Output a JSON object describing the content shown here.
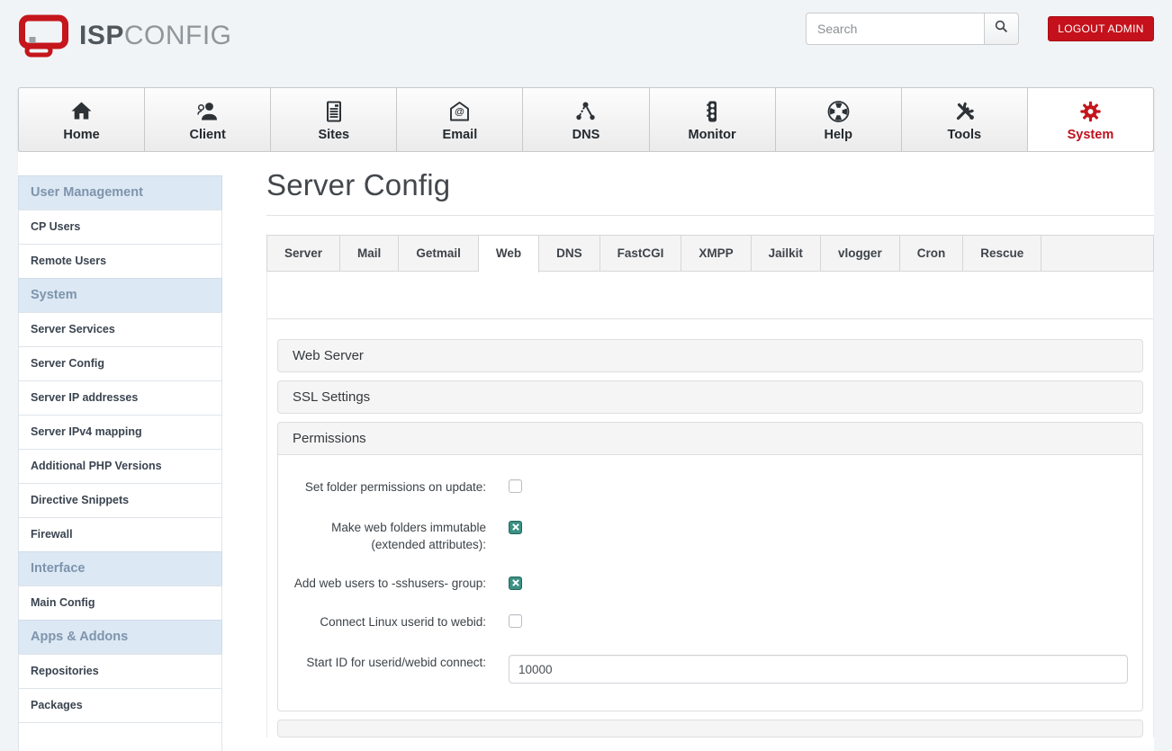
{
  "header": {
    "logo": {
      "text_bold": "ISP",
      "text_light": "CONFIG",
      "icon": "ispconfig-monitor-logo"
    },
    "search": {
      "placeholder": "Search",
      "icon": "search-icon"
    },
    "logout_label": "LOGOUT ADMIN"
  },
  "nav": {
    "items": [
      {
        "label": "Home",
        "icon": "home-icon",
        "active": false
      },
      {
        "label": "Client",
        "icon": "client-icon",
        "active": false
      },
      {
        "label": "Sites",
        "icon": "sites-icon",
        "active": false
      },
      {
        "label": "Email",
        "icon": "email-icon",
        "active": false
      },
      {
        "label": "DNS",
        "icon": "dns-icon",
        "active": false
      },
      {
        "label": "Monitor",
        "icon": "traffic-light-icon",
        "active": false
      },
      {
        "label": "Help",
        "icon": "life-ring-icon",
        "active": false
      },
      {
        "label": "Tools",
        "icon": "tools-icon",
        "active": false
      },
      {
        "label": "System",
        "icon": "gear-icon",
        "active": true
      }
    ]
  },
  "sidebar": {
    "rows": [
      {
        "type": "header",
        "label": "User Management"
      },
      {
        "type": "item",
        "label": "CP Users"
      },
      {
        "type": "item",
        "label": "Remote Users"
      },
      {
        "type": "header",
        "label": "System"
      },
      {
        "type": "item",
        "label": "Server Services"
      },
      {
        "type": "item",
        "label": "Server Config"
      },
      {
        "type": "item",
        "label": "Server IP addresses"
      },
      {
        "type": "item",
        "label": "Server IPv4 mapping"
      },
      {
        "type": "item",
        "label": "Additional PHP Versions"
      },
      {
        "type": "item",
        "label": "Directive Snippets"
      },
      {
        "type": "item",
        "label": "Firewall"
      },
      {
        "type": "header",
        "label": "Interface"
      },
      {
        "type": "item",
        "label": "Main Config"
      },
      {
        "type": "header",
        "label": "Apps & Addons"
      },
      {
        "type": "item",
        "label": "Repositories"
      },
      {
        "type": "item",
        "label": "Packages"
      }
    ]
  },
  "main": {
    "title": "Server Config",
    "tabs": [
      {
        "label": "Server",
        "active": false
      },
      {
        "label": "Mail",
        "active": false
      },
      {
        "label": "Getmail",
        "active": false
      },
      {
        "label": "Web",
        "active": true
      },
      {
        "label": "DNS",
        "active": false
      },
      {
        "label": "FastCGI",
        "active": false
      },
      {
        "label": "XMPP",
        "active": false
      },
      {
        "label": "Jailkit",
        "active": false
      },
      {
        "label": "vlogger",
        "active": false
      },
      {
        "label": "Cron",
        "active": false
      },
      {
        "label": "Rescue",
        "active": false
      }
    ],
    "panels": [
      {
        "title": "Web Server",
        "expanded": false
      },
      {
        "title": "SSL Settings",
        "expanded": false
      },
      {
        "title": "Permissions",
        "expanded": true
      }
    ],
    "form": {
      "fields": [
        {
          "label": "Set folder permissions on update:",
          "type": "checkbox",
          "checked": false
        },
        {
          "label": "Make web folders immutable (extended attributes):",
          "type": "checkbox",
          "checked": true
        },
        {
          "label": "Add web users to -sshusers- group:",
          "type": "checkbox",
          "checked": true
        },
        {
          "label": "Connect Linux userid to webid:",
          "type": "checkbox",
          "checked": false
        },
        {
          "label": "Start ID for userid/webid connect:",
          "type": "text",
          "value": "10000"
        }
      ]
    }
  },
  "colors": {
    "brand_red": "#c4161c",
    "logout_red": "#c4111b",
    "checkbox_checked_teal": "#3a9184",
    "sidebar_header_blue": "#dce8f3"
  }
}
